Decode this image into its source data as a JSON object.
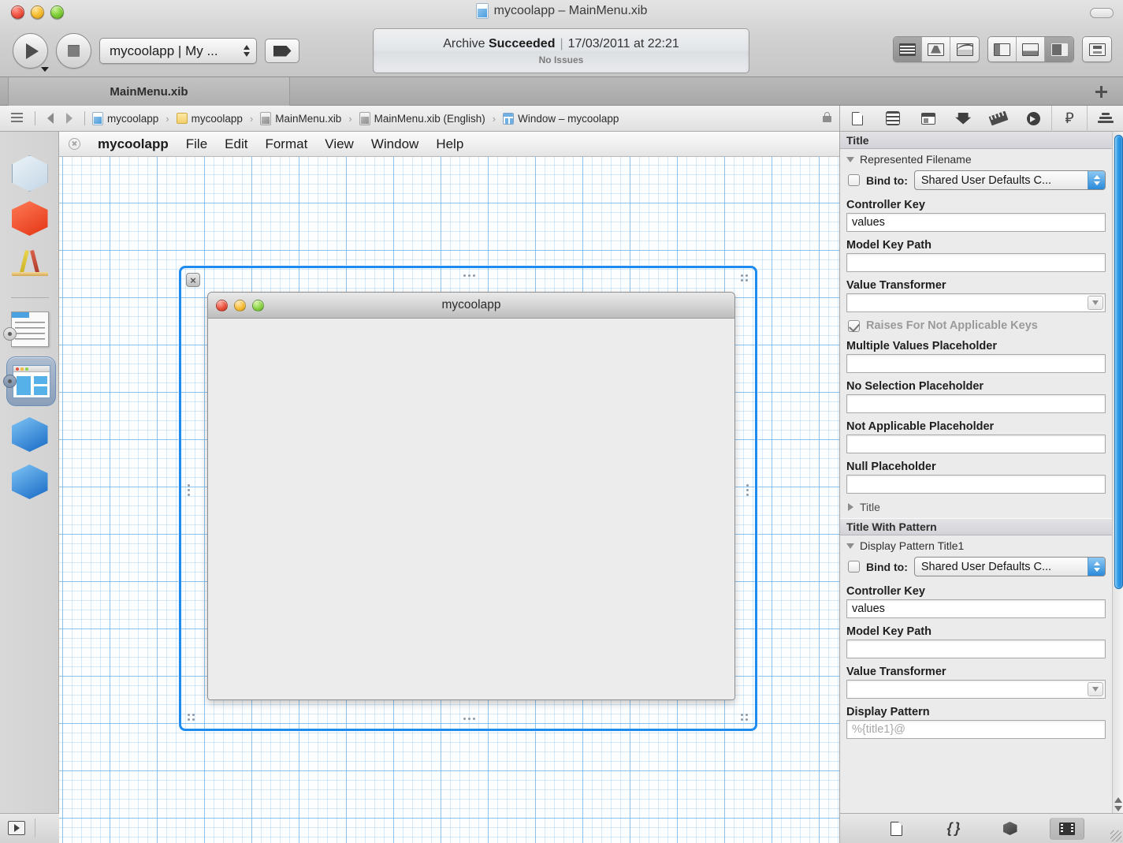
{
  "window": {
    "title": "mycoolapp – MainMenu.xib",
    "file_icon": "xib-file-icon"
  },
  "toolbar": {
    "run_label": "Run",
    "stop_label": "Stop",
    "scheme": "mycoolapp | My ...",
    "breakpoint_label": "Breakpoints",
    "editor_segments": [
      "standard-editor",
      "assistant-editor",
      "version-editor"
    ],
    "view_segments": [
      "hide-navigator",
      "hide-debug-area",
      "hide-utilities"
    ],
    "organizer_label": "Organizer"
  },
  "status": {
    "line1_prefix": "Archive ",
    "line1_bold": "Succeeded",
    "separator": "|",
    "timestamp": "17/03/2011 at 22:21",
    "issues": "No Issues"
  },
  "tabs": {
    "items": [
      {
        "label": "MainMenu.xib",
        "active": true
      }
    ],
    "add_label": "+"
  },
  "jumpbar": {
    "crumbs": [
      {
        "label": "mycoolapp",
        "icon": "xib-project-icon"
      },
      {
        "label": "mycoolapp",
        "icon": "folder-icon"
      },
      {
        "label": "MainMenu.xib",
        "icon": "nib-icon"
      },
      {
        "label": "MainMenu.xib (English)",
        "icon": "nib-icon"
      },
      {
        "label": "Window – mycoolapp",
        "icon": "window-object-icon"
      }
    ],
    "separator": "›",
    "lock_icon": "lock-icon"
  },
  "dock": {
    "items": [
      {
        "name": "file-s-owner",
        "icon": "wireframe-cube-icon"
      },
      {
        "name": "first-responder",
        "icon": "red-cube-icon"
      },
      {
        "name": "application",
        "icon": "ruler-pencil-icon"
      },
      {
        "name": "main-menu",
        "icon": "menu-object-icon"
      },
      {
        "name": "window-mycoolapp",
        "icon": "window-object-icon",
        "selected": true
      },
      {
        "name": "app-delegate",
        "icon": "blue-cube-icon"
      },
      {
        "name": "shared-defaults-controller",
        "icon": "blue-cube-icon"
      }
    ],
    "view_mode_label": "Show document outline"
  },
  "canvas": {
    "menubar": {
      "close_icon": "menubar-close-icon",
      "items": [
        "mycoolapp",
        "File",
        "Edit",
        "Format",
        "View",
        "Window",
        "Help"
      ]
    },
    "selected_window": {
      "title": "mycoolapp",
      "close_badge": "×",
      "traffic_lights": [
        "close",
        "minimize",
        "zoom"
      ]
    }
  },
  "inspector": {
    "tabs": [
      {
        "name": "file-inspector",
        "icon": "file-icon"
      },
      {
        "name": "quick-help-inspector",
        "icon": "help-icon"
      },
      {
        "name": "identity-inspector",
        "icon": "identity-icon"
      },
      {
        "name": "attributes-inspector",
        "icon": "attributes-icon"
      },
      {
        "name": "size-inspector",
        "icon": "ruler-icon"
      },
      {
        "name": "connections-inspector",
        "icon": "connections-icon"
      },
      {
        "name": "bindings-inspector",
        "icon": "bindings-icon",
        "selected": true
      },
      {
        "name": "effects-inspector",
        "icon": "effects-icon"
      }
    ],
    "sections": [
      {
        "header": "Title",
        "group": "Represented Filename",
        "group_expanded": true,
        "bind_label": "Bind to:",
        "bind_checked": false,
        "bind_target": "Shared User Defaults C...",
        "fields": [
          {
            "label": "Controller Key",
            "value": "values",
            "type": "text"
          },
          {
            "label": "Model Key Path",
            "value": "",
            "type": "text"
          },
          {
            "label": "Value Transformer",
            "value": "",
            "type": "combo"
          }
        ],
        "checkbox": {
          "label": "Raises For Not Applicable Keys",
          "checked": true,
          "disabled": true
        },
        "placeholders": [
          {
            "label": "Multiple Values Placeholder",
            "value": ""
          },
          {
            "label": "No Selection Placeholder",
            "value": ""
          },
          {
            "label": "Not Applicable Placeholder",
            "value": ""
          },
          {
            "label": "Null Placeholder",
            "value": ""
          }
        ],
        "collapsed_group": "Title"
      },
      {
        "header": "Title With Pattern",
        "group": "Display Pattern Title1",
        "group_expanded": true,
        "bind_label": "Bind to:",
        "bind_checked": false,
        "bind_target": "Shared User Defaults C...",
        "fields": [
          {
            "label": "Controller Key",
            "value": "values",
            "type": "text"
          },
          {
            "label": "Model Key Path",
            "value": "",
            "type": "text"
          },
          {
            "label": "Value Transformer",
            "value": "",
            "type": "combo"
          },
          {
            "label": "Display Pattern",
            "value": "%{title1}@",
            "type": "text",
            "is_placeholder": true
          }
        ]
      }
    ],
    "library_buttons": [
      {
        "name": "file-template-library",
        "icon": "file-icon"
      },
      {
        "name": "code-snippet-library",
        "icon": "braces-icon"
      },
      {
        "name": "object-library",
        "icon": "cube-icon"
      },
      {
        "name": "media-library",
        "icon": "film-icon",
        "selected": true
      }
    ]
  }
}
